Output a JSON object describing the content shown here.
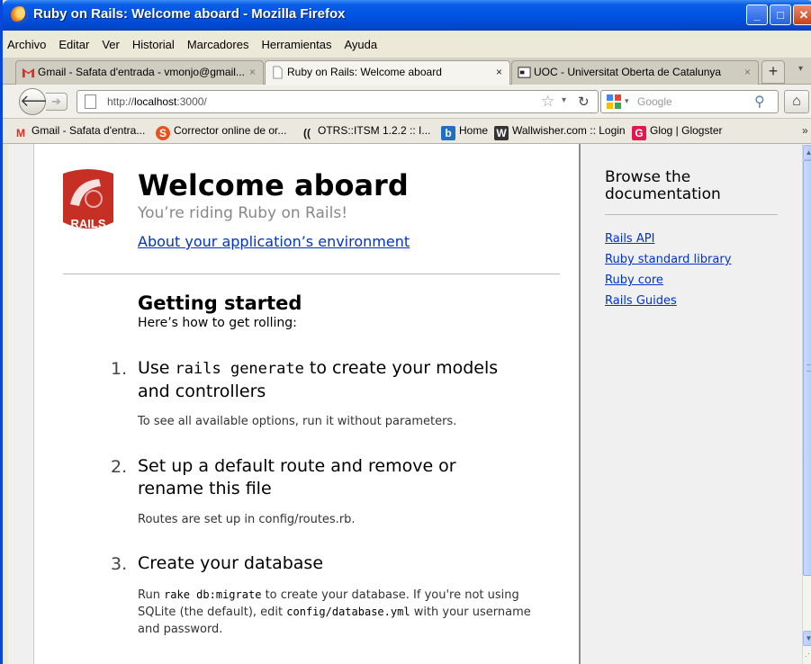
{
  "window": {
    "title": "Ruby on Rails: Welcome aboard - Mozilla Firefox"
  },
  "menu": [
    "Archivo",
    "Editar",
    "Ver",
    "Historial",
    "Marcadores",
    "Herramientas",
    "Ayuda"
  ],
  "tabs": [
    {
      "label": "Gmail - Safata d'entrada - vmonjo@gmail...",
      "close": "×"
    },
    {
      "label": "Ruby on Rails: Welcome aboard",
      "close": "×"
    },
    {
      "label": "UOC - Universitat Oberta de Catalunya",
      "close": "×"
    }
  ],
  "tab_new": "+",
  "nav": {
    "url_prefix": "http://",
    "url_host": "localhost",
    "url_rest": ":3000/",
    "search_placeholder": "Google"
  },
  "bookmarks": [
    "Gmail - Safata d'entra...",
    "Corrector online de or...",
    "OTRS::ITSM 1.2.2 :: I...",
    "Home",
    "Wallwisher.com :: Login",
    "Glog | Glogster"
  ],
  "bookmarks_more": "»",
  "page": {
    "logo_text": "RAILS",
    "heading": "Welcome aboard",
    "subheading": "You’re riding Ruby on Rails!",
    "env_link": "About your application’s environment",
    "getting_started": "Getting started",
    "getting_started_sub": "Here’s how to get rolling:",
    "steps": [
      {
        "num": "1.",
        "title_pre": "Use ",
        "title_code": "rails generate",
        "title_post": " to create your models and controllers",
        "desc": "To see all available options, run it without parameters."
      },
      {
        "num": "2.",
        "title": "Set up a default route and remove or rename this file",
        "desc": "Routes are set up in config/routes.rb."
      },
      {
        "num": "3.",
        "title": "Create your database",
        "desc_1": "Run ",
        "desc_code_1": "rake db:migrate",
        "desc_2": " to create your database. If you're not using SQLite (the default), edit ",
        "desc_code_2": "config/database.yml",
        "desc_3": " with your username and password."
      }
    ]
  },
  "sidebar": {
    "title": "Browse the documentation",
    "links": [
      "Rails API",
      "Ruby standard library",
      "Ruby core",
      "Rails Guides"
    ]
  },
  "colors": {
    "link": "#0033cc",
    "titlebar": "#0054e3",
    "rails_red": "#c52f24"
  }
}
